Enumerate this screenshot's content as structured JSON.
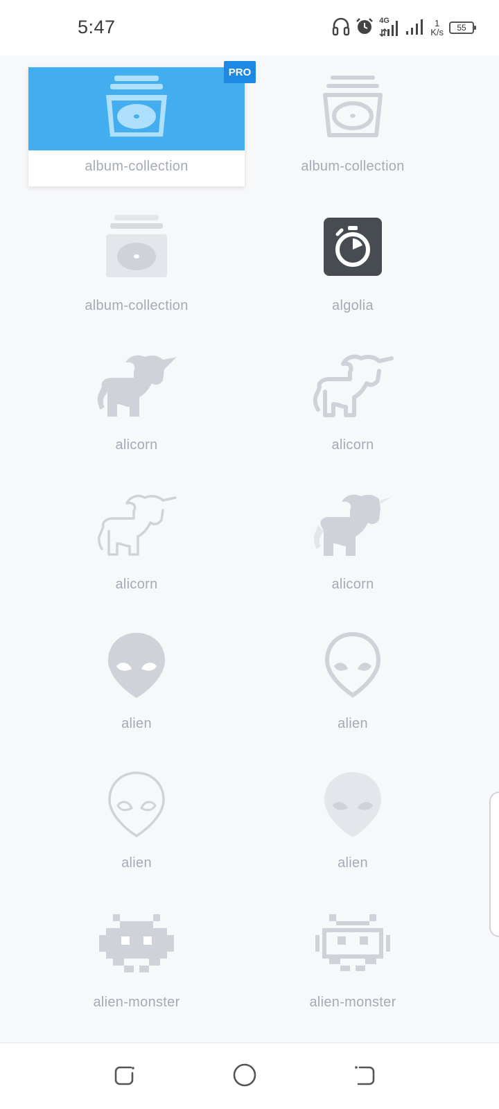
{
  "status_bar": {
    "time": "5:47",
    "network": "4G",
    "net_speed_value": "1",
    "net_speed_unit": "K/s",
    "battery": "55"
  },
  "badge": {
    "pro": "PRO"
  },
  "icons": [
    {
      "label": "album-collection",
      "style": "solid-selected",
      "icon": "album-collection-icon"
    },
    {
      "label": "album-collection",
      "style": "regular",
      "icon": "album-collection-icon"
    },
    {
      "label": "album-collection",
      "style": "duotone",
      "icon": "album-collection-icon"
    },
    {
      "label": "algolia",
      "style": "brand",
      "icon": "algolia-icon"
    },
    {
      "label": "alicorn",
      "style": "solid",
      "icon": "alicorn-icon"
    },
    {
      "label": "alicorn",
      "style": "regular",
      "icon": "alicorn-icon"
    },
    {
      "label": "alicorn",
      "style": "light",
      "icon": "alicorn-icon"
    },
    {
      "label": "alicorn",
      "style": "duotone",
      "icon": "alicorn-icon"
    },
    {
      "label": "alien",
      "style": "solid",
      "icon": "alien-icon"
    },
    {
      "label": "alien",
      "style": "regular",
      "icon": "alien-icon"
    },
    {
      "label": "alien",
      "style": "light",
      "icon": "alien-icon"
    },
    {
      "label": "alien",
      "style": "duotone",
      "icon": "alien-icon"
    },
    {
      "label": "alien-monster",
      "style": "solid",
      "icon": "alien-monster-icon"
    },
    {
      "label": "alien-monster",
      "style": "regular",
      "icon": "alien-monster-icon"
    }
  ],
  "colors": {
    "selected_bg": "#42aef0",
    "pro_badge": "#1e88e5",
    "icon_gray": "#cfd3d9",
    "label_gray": "#a4abb5",
    "algolia_bg": "#474b52"
  }
}
